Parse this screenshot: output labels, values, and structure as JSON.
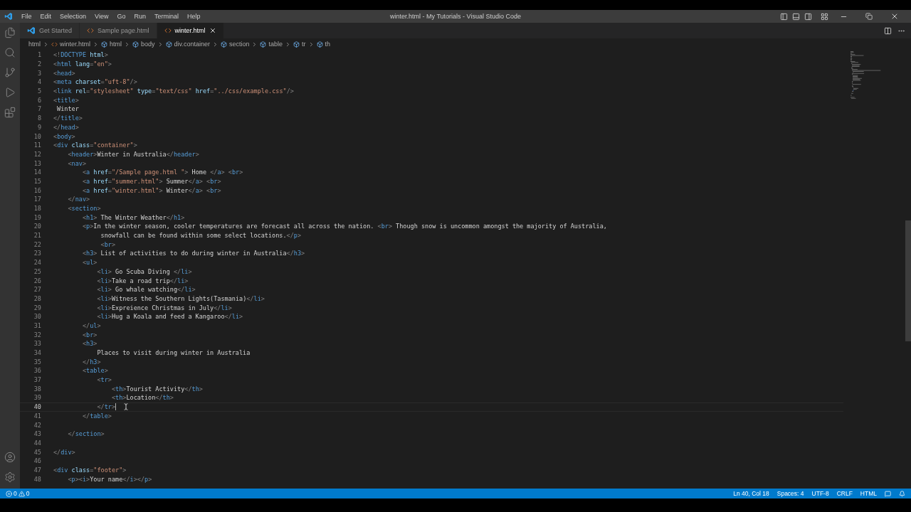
{
  "menu": [
    "File",
    "Edit",
    "Selection",
    "View",
    "Go",
    "Run",
    "Terminal",
    "Help"
  ],
  "window": {
    "title": "winter.html - My Tutorials - Visual Studio Code"
  },
  "tabs": [
    {
      "label": "Get Started",
      "kind": "welcome",
      "selected": false
    },
    {
      "label": "Sample page.html",
      "kind": "html",
      "selected": false
    },
    {
      "label": "winter.html",
      "kind": "html",
      "selected": true
    }
  ],
  "breadcrumbs": [
    {
      "label": "html",
      "kind": "folder"
    },
    {
      "label": "winter.html",
      "kind": "file"
    },
    {
      "label": "html",
      "kind": "element"
    },
    {
      "label": "body",
      "kind": "element"
    },
    {
      "label": "div.container",
      "kind": "element"
    },
    {
      "label": "section",
      "kind": "element"
    },
    {
      "label": "table",
      "kind": "element"
    },
    {
      "label": "tr",
      "kind": "element"
    },
    {
      "label": "th",
      "kind": "element"
    }
  ],
  "editor": {
    "lines": [
      {
        "number": "1",
        "code": "<!DOCTYPE html>",
        "current": false
      },
      {
        "number": "2",
        "code": "<html lang=\"en\">",
        "current": false
      },
      {
        "number": "3",
        "code": "<head>",
        "current": false
      },
      {
        "number": "4",
        "code": "<meta charset=\"uft-8\"/>",
        "current": false
      },
      {
        "number": "5",
        "code": "<link rel=\"stylesheet\" type=\"text/css\" href=\"../css/example.css\"/>",
        "current": false
      },
      {
        "number": "6",
        "code": "<title>",
        "current": false
      },
      {
        "number": "7",
        "code": " Winter",
        "current": false
      },
      {
        "number": "8",
        "code": "</title>",
        "current": false
      },
      {
        "number": "9",
        "code": "</head>",
        "current": false
      },
      {
        "number": "10",
        "code": "<body>",
        "current": false
      },
      {
        "number": "11",
        "code": "<div class=\"container\">",
        "current": false
      },
      {
        "number": "12",
        "code": "    <header>Winter in Australia</header>",
        "current": false
      },
      {
        "number": "13",
        "code": "    <nav>",
        "current": false
      },
      {
        "number": "14",
        "code": "        <a href=\"/Sample page.html \"> Home </a> <br>",
        "current": false
      },
      {
        "number": "15",
        "code": "        <a href=\"summer.html\"> Summer</a> <br>",
        "current": false
      },
      {
        "number": "16",
        "code": "        <a href=\"winter.html\"> Winter</a> <br>",
        "current": false
      },
      {
        "number": "17",
        "code": "    </nav>",
        "current": false
      },
      {
        "number": "18",
        "code": "    <section>",
        "current": false
      },
      {
        "number": "19",
        "code": "        <h1> The Winter Weather</h1>",
        "current": false
      },
      {
        "number": "20",
        "code": "        <p>In the winter season, cooler temperatures are forecast all across the nation. <br> Though snow is uncommon amongst the majority of Australia,",
        "current": false
      },
      {
        "number": "21",
        "code": "             snowfall can be found within some select locations.</p>",
        "current": false
      },
      {
        "number": "22",
        "code": "             <br>",
        "current": false
      },
      {
        "number": "23",
        "code": "        <h3> List of activities to do during winter in Australia</h3>",
        "current": false
      },
      {
        "number": "24",
        "code": "        <ul>",
        "current": false
      },
      {
        "number": "25",
        "code": "            <li> Go Scuba Diving </li>",
        "current": false
      },
      {
        "number": "26",
        "code": "            <li>Take a road trip</li>",
        "current": false
      },
      {
        "number": "27",
        "code": "            <li> Go whale watching</li>",
        "current": false
      },
      {
        "number": "28",
        "code": "            <li>Witness the Southern Lights(Tasmania)</li>",
        "current": false
      },
      {
        "number": "29",
        "code": "            <li>Expreience Christmas in July</li>",
        "current": false
      },
      {
        "number": "30",
        "code": "            <li>Hug a Koala and feed a Kangaroo</li>",
        "current": false
      },
      {
        "number": "31",
        "code": "        </ul>",
        "current": false
      },
      {
        "number": "32",
        "code": "        <br>",
        "current": false
      },
      {
        "number": "33",
        "code": "        <h3>",
        "current": false
      },
      {
        "number": "34",
        "code": "            Places to visit during winter in Australia",
        "current": false
      },
      {
        "number": "35",
        "code": "        </h3>",
        "current": false
      },
      {
        "number": "36",
        "code": "        <table>",
        "current": false
      },
      {
        "number": "37",
        "code": "            <tr>",
        "current": false
      },
      {
        "number": "38",
        "code": "                <th>Tourist Activity</th>",
        "current": false
      },
      {
        "number": "39",
        "code": "                <th>Location</th>",
        "current": false
      },
      {
        "number": "40",
        "code": "            </tr>",
        "current": true
      },
      {
        "number": "41",
        "code": "        </table>",
        "current": false
      },
      {
        "number": "42",
        "current": false
      },
      {
        "number": "43",
        "code": "    </section>",
        "current": false
      },
      {
        "number": "44",
        "current": false
      },
      {
        "number": "45",
        "code": "</div>",
        "current": false
      },
      {
        "number": "46",
        "current": false
      },
      {
        "number": "47",
        "code": "<div class=\"footer\">",
        "current": false
      },
      {
        "number": "48",
        "code": "    <p><i>Your name</i></p>",
        "current": false
      }
    ]
  },
  "status_bar": {
    "errors": "0",
    "warnings": "0",
    "items": [
      "Ln 40, Col 18",
      "Spaces: 4",
      "UTF-8",
      "CRLF",
      "HTML"
    ]
  }
}
